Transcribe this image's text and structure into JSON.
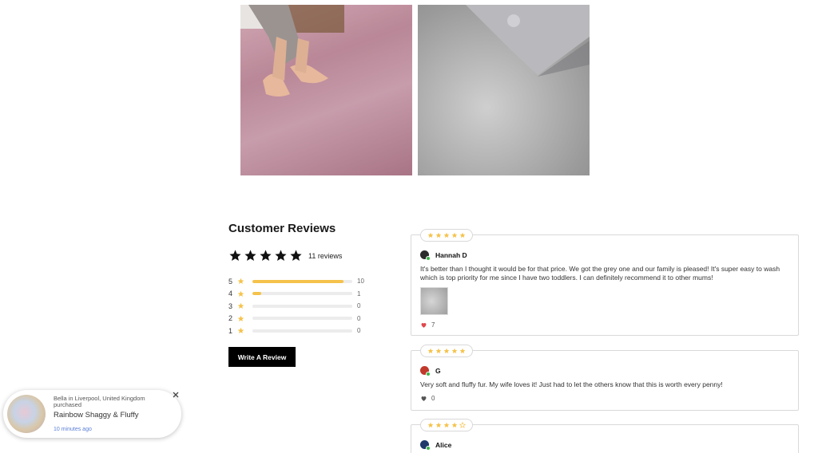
{
  "reviews": {
    "title": "Customer Reviews",
    "average_rating": 5,
    "count_label": "11 reviews",
    "distribution": [
      {
        "stars": "5",
        "count": "10",
        "fraction": 0.91
      },
      {
        "stars": "4",
        "count": "1",
        "fraction": 0.09
      },
      {
        "stars": "3",
        "count": "0",
        "fraction": 0
      },
      {
        "stars": "2",
        "count": "0",
        "fraction": 0
      },
      {
        "stars": "1",
        "count": "0",
        "fraction": 0
      }
    ],
    "write_button": "Write A Review"
  },
  "review_list": [
    {
      "rating": 5,
      "name": "Hannah D",
      "avatar_color": "#2b2b2b",
      "text": "It's better than I thought it would be for that price. We got the grey one and our family is pleased! It's super easy to wash which is top priority for me since I have two toddlers. I can definitely recommend it to other mums!",
      "has_photo": true,
      "likes": "7",
      "liked": true
    },
    {
      "rating": 5,
      "name": "G",
      "avatar_color": "#c0392b",
      "text": "Very soft and fluffy fur. My wife loves it! Just had to let the others know that this is worth every penny!",
      "has_photo": false,
      "likes": "0",
      "liked": false
    },
    {
      "rating": 4,
      "name": "Alice",
      "avatar_color": "#1f3a6b",
      "text": "",
      "has_photo": false,
      "likes": "",
      "liked": false
    }
  ],
  "popup": {
    "line1": "Bella in Liverpool, United Kingdom purchased",
    "product": "Rainbow Shaggy & Fluffy",
    "time": "10 minutes ago"
  },
  "colors": {
    "star": "#f5c34b",
    "star_empty": "#e0e0e0",
    "heart_liked": "#e0474c",
    "heart": "#555555",
    "button": "#000000",
    "popup_time": "#5a7fd6"
  }
}
